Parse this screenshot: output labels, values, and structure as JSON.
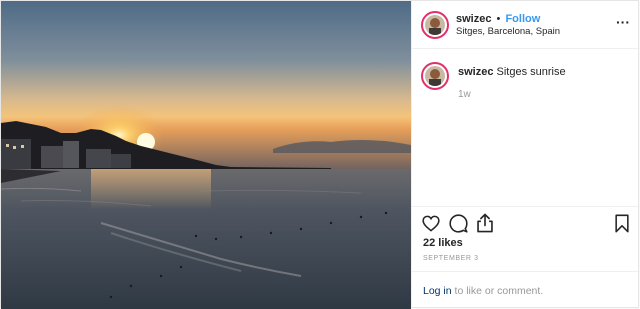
{
  "post": {
    "username": "swizec",
    "separator": "•",
    "follow_label": "Follow",
    "location": "Sitges, Barcelona, Spain",
    "more_icon": "more-horizontal-icon",
    "more_label": "···",
    "photo_subject": "sunrise-over-sea-photo"
  },
  "caption": {
    "username": "swizec",
    "text": "Sitges sunrise",
    "time_ago": "1w"
  },
  "actions": {
    "like_icon": "heart-icon",
    "comment_icon": "comment-icon",
    "share_icon": "share-icon",
    "save_icon": "bookmark-icon"
  },
  "stats": {
    "likes": "22 likes",
    "date": "SEPTEMBER 3"
  },
  "login": {
    "link_label": "Log in",
    "rest": "to like or comment."
  },
  "colors": {
    "accent": "#3897f0",
    "link_dark": "#003569",
    "muted": "#999999",
    "text": "#262626",
    "avatar_ring": "#e1306c"
  }
}
